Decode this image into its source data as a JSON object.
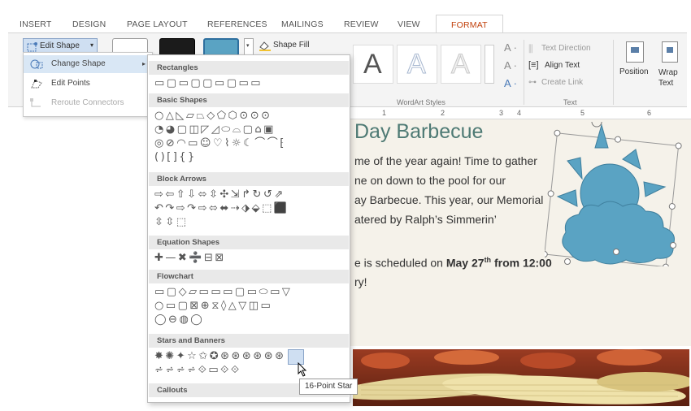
{
  "ribbon": {
    "tabs": [
      "INSERT",
      "DESIGN",
      "PAGE LAYOUT",
      "REFERENCES",
      "MAILINGS",
      "REVIEW",
      "VIEW",
      "FORMAT"
    ],
    "active_tab": "FORMAT",
    "edit_shape_label": "Edit Shape",
    "shape_fill_label": "Shape Fill",
    "wordart_letter": "A",
    "wordart_group": "WordArt Styles",
    "text_direction_label": "Text Direction",
    "align_text_label": "Align Text",
    "create_link_label": "Create Link",
    "text_group": "Text",
    "position_label": "Position",
    "wrap_text_label": "Wrap Text"
  },
  "edit_menu": {
    "items": [
      {
        "label": "Change Shape",
        "state": "hover"
      },
      {
        "label": "Edit Points",
        "state": "normal"
      },
      {
        "label": "Reroute Connectors",
        "state": "disabled"
      }
    ]
  },
  "gallery": {
    "categories": [
      {
        "name": "Rectangles",
        "rows": [
          "▭▢▭▢▢▭▢▭▭"
        ]
      },
      {
        "name": "Basic Shapes",
        "rows": [
          "○△◺▱⏢◇⬠⬡⊙⊙⊙",
          "◔◕▢◫◸◿⬭⌓▢⌂▣",
          "◎⊘◠▭☺♡⌇☼☾⌒⌒⁅",
          "()[]{}"
        ]
      },
      {
        "name": "Block Arrows",
        "rows": [
          "⇨⇦⇧⇩⬄⇳✣⇲↱↻↺⇗",
          "↶↷⇨↷⇨⬄⬌⇢⬗⬙⬚⬛",
          "⇳⇳⬚"
        ]
      },
      {
        "name": "Equation Shapes",
        "rows": [
          "✚—✖➗⊟⊠"
        ]
      },
      {
        "name": "Flowchart",
        "rows": [
          "▭▢◇▱▭▭▭▢▭⬭▭▽",
          "○▭▢⊠⊕⧖◊△▽◫▭",
          "◯⊖◍◯"
        ]
      },
      {
        "name": "Stars and Banners",
        "rows": [
          "✸✺✦☆✩✪⊛⊛⊛⊛⊛⊛",
          "⩫⩫⩫⩫⟐▭⟐⟐"
        ]
      },
      {
        "name": "Callouts",
        "rows": [
          ""
        ]
      }
    ],
    "tooltip": "16-Point Star"
  },
  "document": {
    "ruler_numbers": [
      "1",
      "2",
      "3",
      "4",
      "5",
      "6"
    ],
    "title": "Day Barbecue",
    "lines": [
      "me of the year again! Time to gather",
      "ne on down to the pool for our",
      "ay Barbecue. This year, our Memorial",
      "atered by Ralph’s Simmerin’",
      "e is scheduled on ",
      "ry!"
    ],
    "bold_date": "May 27",
    "bold_sup": "th",
    "bold_time": " from 12:00"
  },
  "colors": {
    "accent": "#c2410c",
    "doc_title": "#4e7a74",
    "sun_cloud": "#5aa3c3",
    "page_bg": "#f5f2ea"
  }
}
